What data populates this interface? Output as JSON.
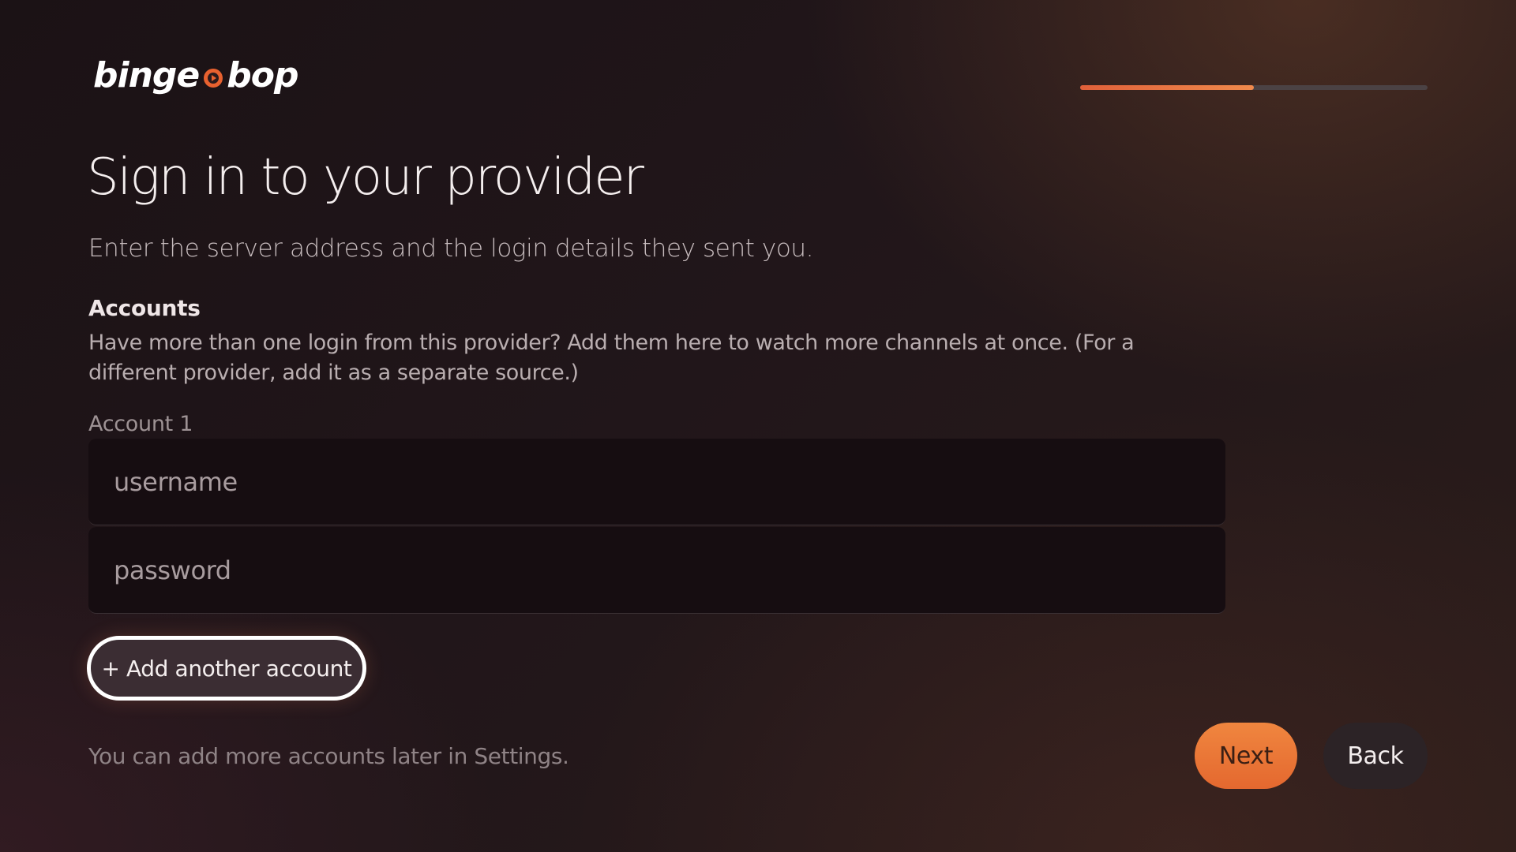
{
  "brand": {
    "word1": "binge",
    "word2": "bop",
    "accent_color": "#e8612f"
  },
  "progress": {
    "fraction": 0.5,
    "fill_color": "#ec7440",
    "track_color": "#4b4244"
  },
  "page": {
    "title": "Sign in to your provider",
    "subtitle": "Enter the server address and the login details they sent you."
  },
  "accounts": {
    "heading": "Accounts",
    "description": "Have more than one login from this provider? Add them here to watch more channels at once. (For a different provider, add it as a separate source.)",
    "items": [
      {
        "label": "Account 1",
        "username": {
          "value": "",
          "placeholder": "username"
        },
        "password": {
          "value": "",
          "placeholder": "password"
        }
      }
    ],
    "add_label": "+ Add another account"
  },
  "footer": {
    "note": "You can add more accounts later in Settings.",
    "next_label": "Next",
    "back_label": "Back"
  }
}
